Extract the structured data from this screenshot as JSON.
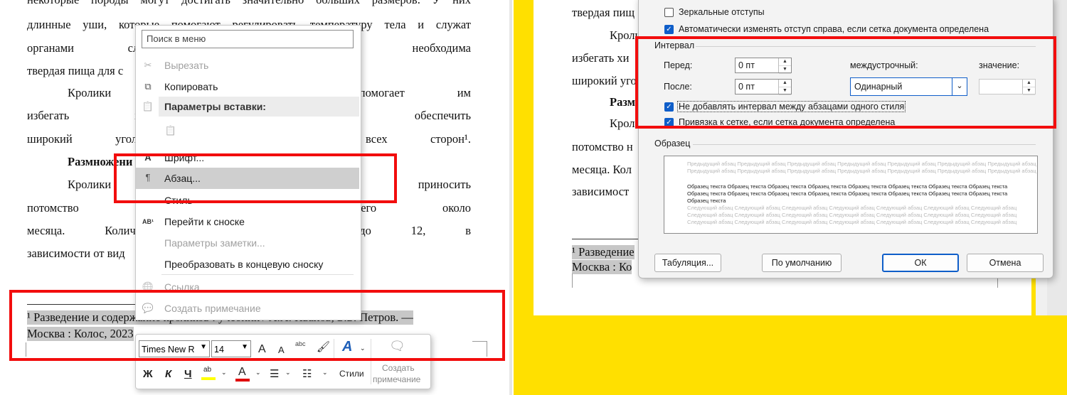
{
  "document": {
    "lines": [
      {
        "text": "некоторые породы могут достигать значительно больших размеров. У них",
        "just": true
      },
      {
        "text": "длинные уши, которые помогают регулировать температуру тела и служат",
        "just": true
      },
      {
        "text": "органами слуха. З                                           ому им необходима",
        "just": true
      },
      {
        "text": "твердая пища для с",
        "just": false
      },
      {
        "text": "Кролики об                                         и, что помогает им",
        "just": true
      },
      {
        "text": "избегать хищников                                          , чтобы обеспечить",
        "just": true
      },
      {
        "text": "широкий угол обзор                                          ски со всех сторон¹.",
        "just": true
      },
      {
        "text": "Размножени",
        "just": false
      },
      {
        "text": "Кролики    ра                                                   может   приносить",
        "just": true
      },
      {
        "text": "потомство несколь                                                 длится всего около",
        "just": true
      },
      {
        "text": "месяца. Количеств                                            уется  от  1  до  12,  в",
        "just": true
      },
      {
        "text": "зависимости от вид",
        "just": false
      }
    ],
    "footnote_line1": "¹ Разведение и содержание кроликов : учебник / А.А. Иванов, Б.Б. Петров. —",
    "footnote_line2": "Москва : Колос, 2023"
  },
  "context_menu": {
    "search_placeholder": "Поиск в меню",
    "items": [
      {
        "label": "Вырезать",
        "icon": "scissors-icon",
        "glyph": "✂",
        "disabled": true
      },
      {
        "label": "Копировать",
        "icon": "copy-icon",
        "glyph": "⧉",
        "disabled": false
      },
      {
        "label": "Параметры вставки:",
        "icon": "paste-icon",
        "glyph": "📋",
        "disabled": false,
        "header": true
      },
      {
        "label": "",
        "icon": "paste-option-icon",
        "glyph": "📋",
        "disabled": true
      },
      {
        "label": "Шрифт...",
        "icon": "font-icon",
        "glyph": "A",
        "disabled": false
      },
      {
        "label": "Абзац...",
        "icon": "paragraph-icon",
        "glyph": "¶",
        "disabled": false,
        "highlight": true
      },
      {
        "label": "Стиль",
        "icon": "",
        "glyph": "",
        "disabled": false
      },
      {
        "label": "Перейти к сноске",
        "icon": "goto-footnote-icon",
        "glyph": "AB¹",
        "disabled": false
      },
      {
        "label": "Параметры заметки...",
        "icon": "",
        "glyph": "",
        "disabled": true
      },
      {
        "label": "Преобразовать в концевую сноску",
        "icon": "",
        "glyph": "",
        "disabled": false
      },
      {
        "label": "Ссылка",
        "icon": "link-icon",
        "glyph": "🌐",
        "disabled": true
      },
      {
        "label": "Создать примечание",
        "icon": "comment-icon",
        "glyph": "💬",
        "disabled": true
      }
    ]
  },
  "mini_toolbar": {
    "font_name": "Times New R",
    "font_size": "14",
    "grow": "A",
    "shrink": "A",
    "bold": "Ж",
    "italic": "К",
    "underline": "Ч",
    "styles": "Стили",
    "new_comment_line1": "Создать",
    "new_comment_line2": "примечание",
    "highlight_color": "#ffff00",
    "font_color": "#e00000"
  },
  "right_document": {
    "lines": [
      "твердая пищ",
      "Кроли",
      "избегать хи",
      "широкий уго",
      "Разм",
      "Крол",
      "потомство н",
      "месяца. Кол",
      "зависимост"
    ],
    "footnote_line1": "¹ Разведение",
    "footnote_line2": "Москва : Ко"
  },
  "dialog": {
    "mirror_indents": "Зеркальные отступы",
    "auto_adjust": "Автоматически изменять отступ справа, если сетка документа определена",
    "spacing_group": "Интервал",
    "before_label": "Перед:",
    "before_value": "0 пт",
    "after_label": "После:",
    "after_value": "0 пт",
    "line_spacing_label": "междустрочный:",
    "line_spacing_value": "Одинарный",
    "at_label": "значение:",
    "at_value": "",
    "dont_add_space": "Не добавлять интервал между абзацами одного стиля",
    "snap_to_grid": "Привязка к сетке, если сетка документа определена",
    "preview_group": "Образец",
    "preview_prev": "Предыдущий абзац Предыдущий абзац Предыдущий абзац Предыдущий абзац Предыдущий абзац Предыдущий абзац Предыдущий абзац",
    "preview_prev2": "Предыдущий абзац Предыдущий абзац Предыдущий абзац Предыдущий абзац Предыдущий абзац Предыдущий абзац Предыдущий абзац",
    "preview_sample": "Образец текста Образец текста Образец текста Образец текста Образец текста Образец текста Образец текста Образец текста",
    "preview_sample_last": "Образец текста",
    "preview_next": "Следующий абзац Следующий абзац Следующий абзац Следующий абзац Следующий абзац Следующий абзац Следующий абзац",
    "tabs_button": "Табуляция...",
    "default_button": "По умолчанию",
    "ok_button": "ОК",
    "cancel_button": "Отмена"
  },
  "colors": {
    "accent": "#0f5ec9",
    "highlight_red": "#f20d0d",
    "yellow": "#ffe000"
  }
}
